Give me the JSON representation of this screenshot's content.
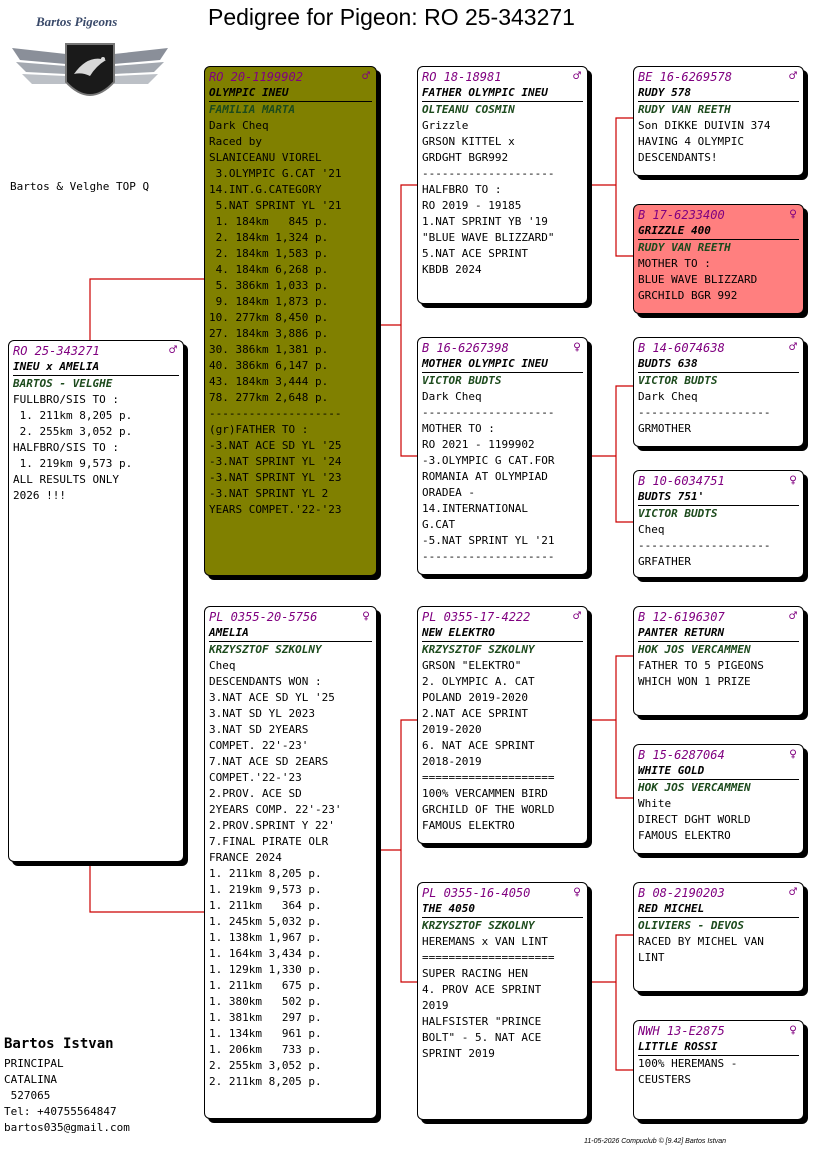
{
  "title": "Pedigree for Pigeon: RO  25-343271",
  "logo": {
    "text": "Bartos Pigeons"
  },
  "side_note": "Bartos & Velghe TOP Q",
  "colors": {
    "pedigree_line": "#cc0000",
    "olive": "#808000",
    "pink": "#ff7f7f",
    "ring": "#800080",
    "breeder": "#1c4a1c"
  },
  "subject": {
    "ring": "RO  25-343271",
    "sex": "♂",
    "name": "INEU x AMELIA",
    "breeder": "BARTOS - VELGHE",
    "lines": [
      "",
      "FULLBRO/SIS TO :",
      " 1. 211km 8,205 p.",
      " 2. 255km 3,052 p.",
      "HALFBRO/SIS TO :",
      " 1. 219km 9,573 p.",
      "",
      "ALL RESULTS ONLY",
      "2026 !!!"
    ]
  },
  "sire": {
    "ring": "RO  20-1199902",
    "sex": "♂",
    "name": "OLYMPIC INEU",
    "breeder": "FAMILIA MARTA",
    "lines": [
      "Dark Cheq",
      "Raced by",
      "SLANICEANU VIOREL",
      " 3.OLYMPIC G.CAT '21",
      "14.INT.G.CATEGORY",
      " 5.NAT SPRINT YL '21",
      " 1. 184km   845 p.",
      " 2. 184km 1,324 p.",
      " 2. 184km 1,583 p.",
      " 4. 184km 6,268 p.",
      " 5. 386km 1,033 p.",
      " 9. 184km 1,873 p.",
      "10. 277km 8,450 p.",
      "27. 184km 3,886 p.",
      "30. 386km 1,381 p.",
      "40. 386km 6,147 p.",
      "43. 184km 3,444 p.",
      "78. 277km 2,648 p.",
      "--------------------",
      "(gr)FATHER TO :",
      "-3.NAT ACE SD YL '25",
      "-3.NAT SPRINT YL '24",
      "-3.NAT SPRINT YL '23",
      "-3.NAT SPRINT YL 2",
      "YEARS COMPET.'22-'23"
    ]
  },
  "dam": {
    "ring": "PL  0355-20-5756",
    "sex": "♀",
    "name": "AMELIA",
    "breeder": "KRZYSZTOF SZKOLNY",
    "lines": [
      "Cheq",
      "DESCENDANTS WON :",
      "3.NAT ACE SD YL '25",
      "3.NAT SD YL 2023",
      "3.NAT SD 2YEARS",
      "COMPET. 22'-23'",
      "7.NAT ACE SD 2EARS",
      "COMPET.'22-'23",
      "2.PROV. ACE SD",
      "2YEARS COMP. 22'-23'",
      "2.PROV.SPRINT Y 22'",
      "7.FINAL PIRATE OLR",
      "FRANCE 2024",
      "1. 211km 8,205 p.",
      "1. 219km 9,573 p.",
      "1. 211km   364 p.",
      "1. 245km 5,032 p.",
      "1. 138km 1,967 p.",
      "1. 164km 3,434 p.",
      "1. 129km 1,330 p.",
      "1. 211km   675 p.",
      "1. 380km   502 p.",
      "1. 381km   297 p.",
      "1. 134km   961 p.",
      "1. 206km   733 p.",
      "2. 255km 3,052 p.",
      "2. 211km 8,205 p."
    ]
  },
  "ss": {
    "ring": "RO  18-18981",
    "sex": "♂",
    "name": "FATHER OLYMPIC INEU",
    "breeder": "OLTEANU COSMIN",
    "lines": [
      "Grizzle",
      "GRSON KITTEL x",
      "GRDGHT BGR992",
      "--------------------",
      "HALFBRO TO :",
      "RO 2019 - 19185",
      "1.NAT SPRINT YB '19",
      "\"BLUE WAVE BLIZZARD\"",
      "5.NAT ACE SPRINT",
      "KBDB 2024"
    ]
  },
  "sd": {
    "ring": "B  16-6267398",
    "sex": "♀",
    "name": "MOTHER OLYMPIC INEU",
    "breeder": "VICTOR BUDTS",
    "lines": [
      "Dark Cheq",
      "--------------------",
      "MOTHER TO :",
      "RO 2021 - 1199902",
      "-3.OLYMPIC G CAT.FOR",
      "ROMANIA AT OLYMPIAD",
      "ORADEA -",
      "14.INTERNATIONAL",
      "G.CAT",
      "-5.NAT SPRINT YL '21",
      "--------------------"
    ]
  },
  "ds": {
    "ring": "PL  0355-17-4222",
    "sex": "♂",
    "name": "NEW ELEKTRO",
    "breeder": "KRZYSZTOF SZKOLNY",
    "lines": [
      "GRSON \"ELEKTRO\"",
      "2. OLYMPIC A. CAT",
      "POLAND 2019-2020",
      "2.NAT ACE SPRINT",
      "2019-2020",
      "6. NAT ACE SPRINT",
      "2018-2019",
      "====================",
      "100% VERCAMMEN BIRD",
      "GRCHILD OF THE WORLD",
      "FAMOUS ELEKTRO"
    ]
  },
  "dd": {
    "ring": "PL  0355-16-4050",
    "sex": "♀",
    "name": "THE 4050",
    "breeder": "KRZYSZTOF SZKOLNY",
    "lines": [
      "HEREMANS x VAN LINT",
      "====================",
      "SUPER RACING HEN",
      "4. PROV ACE SPRINT",
      "2019",
      "HALFSISTER \"PRINCE",
      "BOLT\" - 5. NAT ACE",
      "SPRINT 2019"
    ]
  },
  "sss": {
    "ring": "BE  16-6269578",
    "sex": "♂",
    "name": "RUDY 578",
    "breeder": "RUDY VAN REETH",
    "lines": [
      "Son DIKKE DUIVIN 374",
      "HAVING 4 OLYMPIC",
      "DESCENDANTS!"
    ]
  },
  "ssd": {
    "ring": "B  17-6233400",
    "sex": "♀",
    "name": "GRIZZLE 400",
    "breeder": "RUDY VAN REETH",
    "lines": [
      "MOTHER TO :",
      "BLUE WAVE BLIZZARD",
      "GRCHILD BGR 992"
    ]
  },
  "sds": {
    "ring": "B  14-6074638",
    "sex": "♂",
    "name": "BUDTS 638",
    "breeder": "VICTOR BUDTS",
    "lines": [
      "Dark Cheq",
      "--------------------",
      "",
      "GRMOTHER"
    ]
  },
  "sdd": {
    "ring": "B  10-6034751",
    "sex": "♀",
    "name": "BUDTS 751'",
    "breeder": "VICTOR BUDTS",
    "lines": [
      "Cheq",
      "--------------------",
      "",
      "GRFATHER"
    ]
  },
  "dss": {
    "ring": "B  12-6196307",
    "sex": "♂",
    "name": "PANTER RETURN",
    "breeder": "HOK JOS VERCAMMEN",
    "lines": [
      "",
      "FATHER TO 5 PIGEONS",
      "WHICH WON 1 PRIZE"
    ]
  },
  "dsd": {
    "ring": "B  15-6287064",
    "sex": "♀",
    "name": "WHITE GOLD",
    "breeder": "HOK JOS VERCAMMEN",
    "lines": [
      "White",
      "DIRECT DGHT WORLD",
      "FAMOUS ELEKTRO"
    ]
  },
  "dds": {
    "ring": "B  08-2190203",
    "sex": "♂",
    "name": "RED MICHEL",
    "breeder": "OLIVIERS - DEVOS",
    "lines": [
      "",
      "RACED BY MICHEL VAN",
      "LINT"
    ]
  },
  "ddd": {
    "ring": "NWH 13-E2875",
    "sex": "♀",
    "name": "LITTLE ROSSI",
    "breeder": "",
    "lines": [
      "",
      "",
      "100% HEREMANS -",
      "CEUSTERS"
    ]
  },
  "owner": {
    "name": "Bartos Istvan",
    "lines": [
      "PRINCIPAL",
      "CATALINA",
      " 527065",
      "Tel: +40755564847",
      "bartos035@gmail.com"
    ]
  },
  "footer": "11-05-2026   Compuclub © [9.42]  Bartos Istvan"
}
